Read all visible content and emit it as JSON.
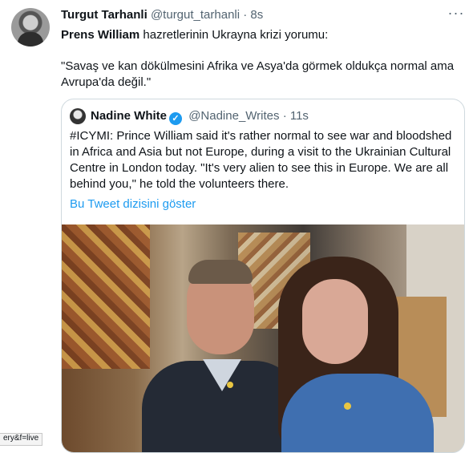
{
  "tweet": {
    "author_name": "Turgut Tarhanli",
    "author_handle": "@turgut_tarhanli",
    "separator": "·",
    "timestamp": "8s",
    "more_label": "···",
    "text_bold": "Prens William",
    "text_rest": " hazretlerinin Ukrayna krizi yorumu:",
    "quote": "\"Savaş ve kan dökülmesini Afrika ve Asya'da görmek oldukça normal ama Avrupa'da değil.\""
  },
  "quoted_tweet": {
    "author_name": "Nadine White",
    "verified_mark": "✓",
    "author_handle": "@Nadine_Writes",
    "separator": "·",
    "timestamp": "11s",
    "text": "#ICYMI: Prince William said it's rather normal to see war and bloodshed in Africa and Asia but not Europe, during a visit to the Ukrainian Cultural Centre in London today. \"It's very alien to see this in Europe. We are all behind you,\" he told the volunteers there.",
    "show_thread": "Bu Tweet dizisini göster"
  },
  "status_bar": {
    "url": "ery&f=live"
  },
  "colors": {
    "link": "#1d9bf0",
    "muted": "#536471",
    "text": "#0f1419",
    "border": "#cfd9de"
  }
}
